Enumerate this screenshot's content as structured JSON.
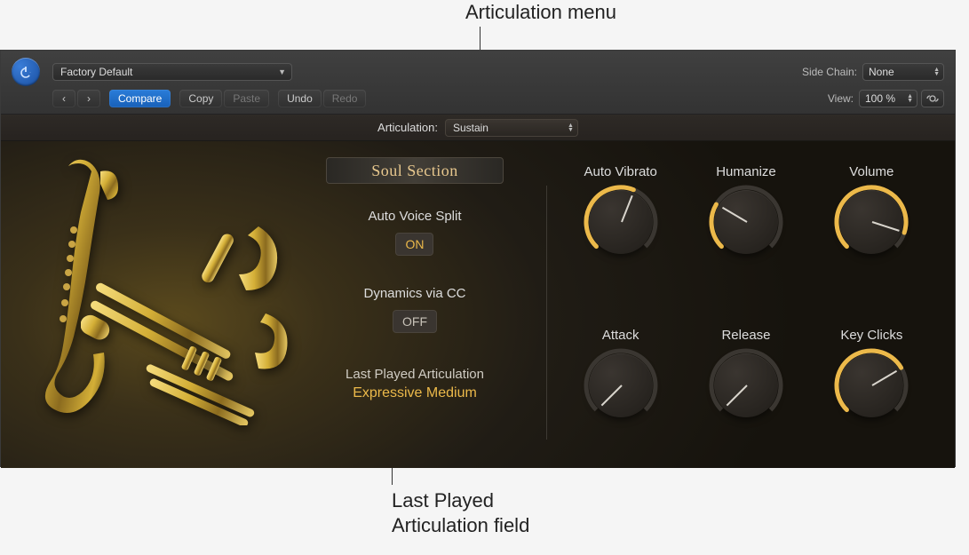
{
  "annotations": {
    "top": "Articulation menu",
    "bottom_line1": "Last Played",
    "bottom_line2": "Articulation field"
  },
  "toolbar": {
    "preset": "Factory Default",
    "compare": "Compare",
    "copy": "Copy",
    "paste": "Paste",
    "undo": "Undo",
    "redo": "Redo",
    "sidechain_label": "Side Chain:",
    "sidechain_value": "None",
    "view_label": "View:",
    "view_value": "100 %"
  },
  "articulation": {
    "label": "Articulation:",
    "value": "Sustain"
  },
  "center": {
    "section_name": "Soul Section",
    "auto_voice_split_label": "Auto Voice Split",
    "auto_voice_split_value": "ON",
    "dynamics_label": "Dynamics via CC",
    "dynamics_value": "OFF",
    "last_played_label": "Last Played Articulation",
    "last_played_value": "Expressive Medium"
  },
  "knobs": {
    "auto_vibrato": {
      "label": "Auto Vibrato",
      "value": 0.58
    },
    "humanize": {
      "label": "Humanize",
      "value": 0.28
    },
    "volume": {
      "label": "Volume",
      "value": 0.9
    },
    "attack": {
      "label": "Attack",
      "value": 0.0
    },
    "release": {
      "label": "Release",
      "value": 0.0
    },
    "key_clicks": {
      "label": "Key Clicks",
      "value": 0.72
    }
  }
}
